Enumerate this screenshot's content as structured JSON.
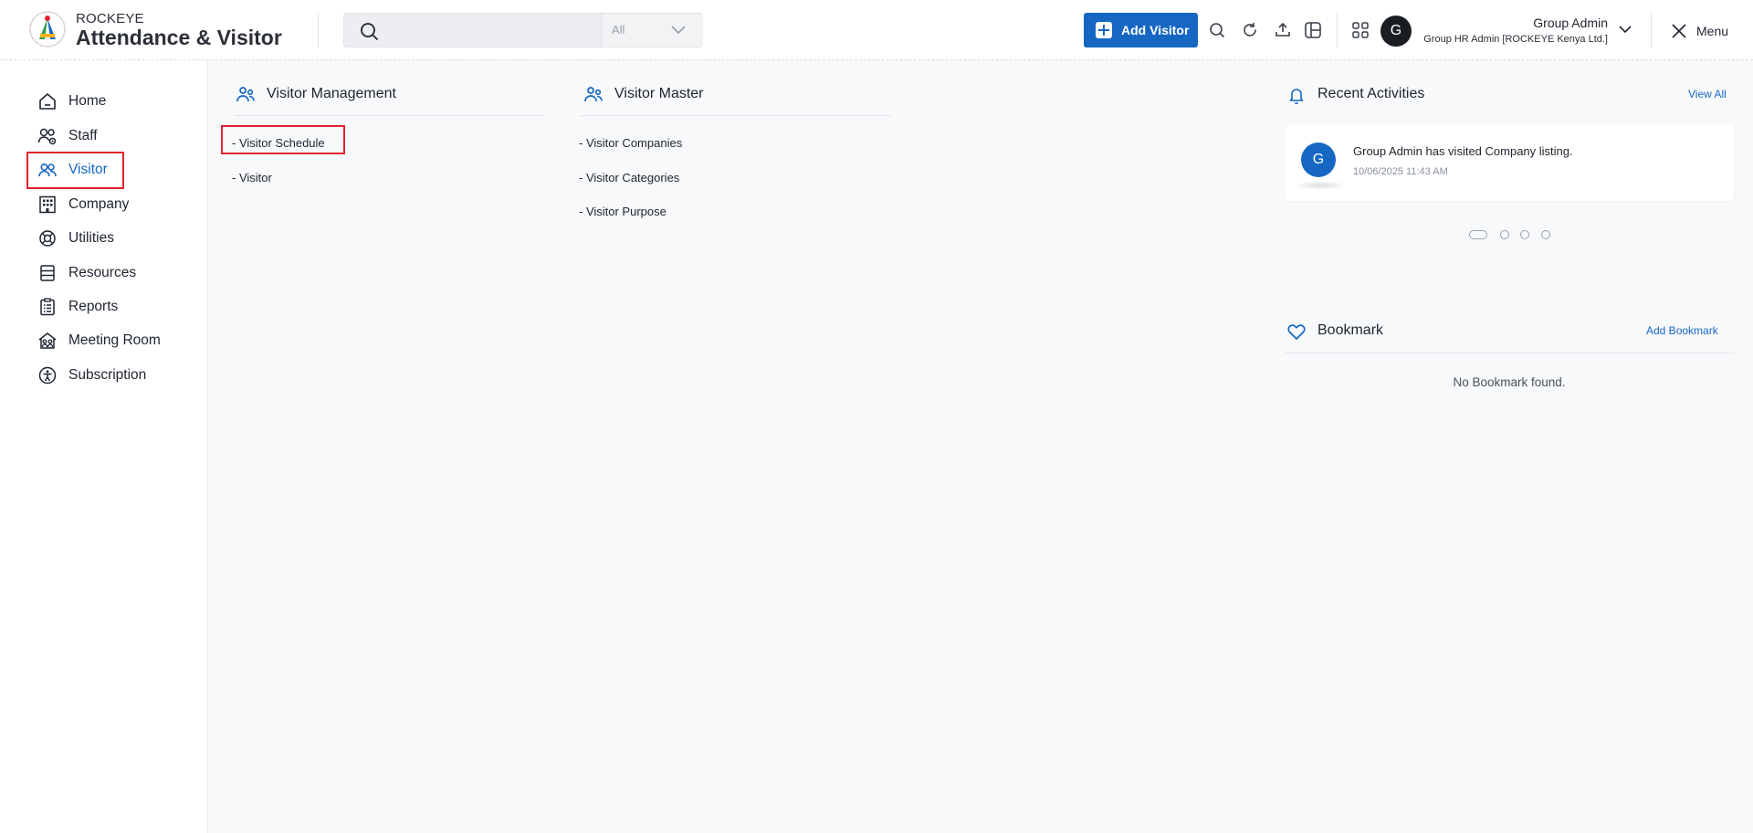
{
  "app": {
    "brand_small": "ROCKEYE",
    "brand_main": "Attendance & Visitor"
  },
  "search": {
    "placeholder": "",
    "scope": "All"
  },
  "header": {
    "add_visitor_label": "Add Visitor",
    "avatar_letter": "G",
    "user_name": "Group Admin",
    "user_role": "Group HR Admin [ROCKEYE Kenya Ltd.]",
    "menu_label": "Menu",
    "tools": [
      "search-icon",
      "refresh-icon",
      "upload-icon",
      "layout-icon",
      "apps-grid-icon"
    ]
  },
  "sidebar": {
    "items": [
      {
        "label": "Home",
        "icon": "home-icon"
      },
      {
        "label": "Staff",
        "icon": "staff-icon"
      },
      {
        "label": "Visitor",
        "icon": "visitor-icon",
        "active": true
      },
      {
        "label": "Company",
        "icon": "company-icon"
      },
      {
        "label": "Utilities",
        "icon": "utilities-icon"
      },
      {
        "label": "Resources",
        "icon": "resources-icon"
      },
      {
        "label": "Reports",
        "icon": "reports-icon"
      },
      {
        "label": "Meeting Room",
        "icon": "meeting-room-icon"
      },
      {
        "label": "Subscription",
        "icon": "subscription-icon"
      }
    ]
  },
  "visitor_management": {
    "title": "Visitor Management",
    "links": [
      "- Visitor Schedule",
      "- Visitor"
    ]
  },
  "visitor_master": {
    "title": "Visitor Master",
    "links": [
      "- Visitor Companies",
      "- Visitor Categories",
      "- Visitor Purpose"
    ]
  },
  "recent_activities": {
    "title": "Recent Activities",
    "view_all_label": "View All",
    "items": [
      {
        "avatar_letter": "G",
        "text": "Group Admin has visited Company listing.",
        "time": "10/06/2025 11:43 AM"
      }
    ],
    "pager_pages": 4,
    "pager_active": 1
  },
  "bookmark": {
    "title": "Bookmark",
    "add_label": "Add Bookmark",
    "empty_text": "No Bookmark found."
  },
  "colors": {
    "accent": "#1667c2",
    "highlight": "#e0232e",
    "background": "#f7f9fb"
  }
}
